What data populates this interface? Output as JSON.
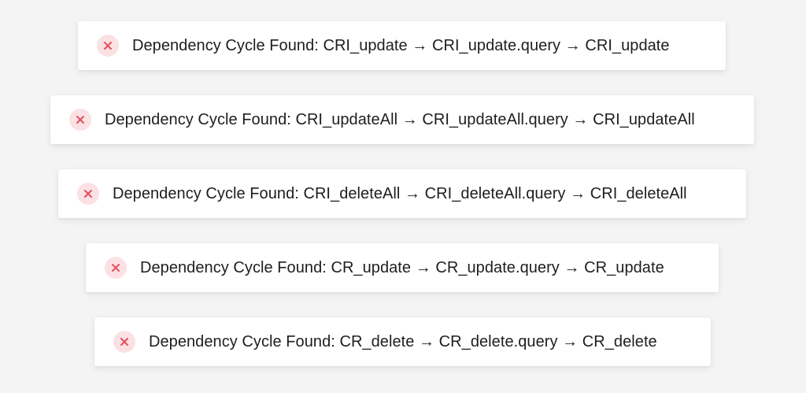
{
  "accent_colors": {
    "error_icon_bg": "#fbe1e3",
    "error_icon_x": "#e2515f"
  },
  "toasts": [
    {
      "icon": "close-icon",
      "message": "Dependency Cycle Found: CRI_update → CRI_update.query → CRI_update"
    },
    {
      "icon": "close-icon",
      "message": "Dependency Cycle Found: CRI_updateAll → CRI_updateAll.query → CRI_updateAll"
    },
    {
      "icon": "close-icon",
      "message": "Dependency Cycle Found: CRI_deleteAll → CRI_deleteAll.query → CRI_deleteAll"
    },
    {
      "icon": "close-icon",
      "message": "Dependency Cycle Found: CR_update → CR_update.query → CR_update"
    },
    {
      "icon": "close-icon",
      "message": "Dependency Cycle Found: CR_delete → CR_delete.query → CR_delete"
    }
  ]
}
